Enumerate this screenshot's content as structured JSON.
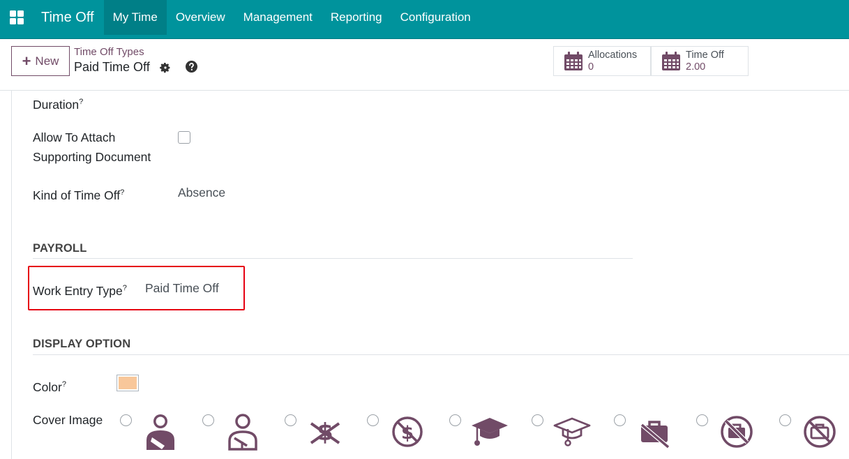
{
  "navbar": {
    "app_name": "Time Off",
    "menu": [
      "My Time",
      "Overview",
      "Management",
      "Reporting",
      "Configuration"
    ],
    "active_index": 0,
    "color": "#00939c"
  },
  "control_panel": {
    "new_label": "New",
    "breadcrumb": "Time Off Types",
    "record_title": "Paid Time Off",
    "stats": [
      {
        "label": "Allocations",
        "value": "0"
      },
      {
        "label": "Time Off",
        "value": "2.00"
      }
    ]
  },
  "form": {
    "duration_label": "Duration",
    "attach_label_1": "Allow To Attach",
    "attach_label_2": "Supporting Document",
    "kind_label": "Kind of Time Off",
    "kind_value": "Absence",
    "payroll_section": "PAYROLL",
    "work_entry_label": "Work Entry Type",
    "work_entry_value": "Paid Time Off",
    "display_section": "DISPLAY OPTION",
    "color_label": "Color",
    "color_value": "#f8c79a",
    "cover_image_label": "Cover Image",
    "help_mark": "?",
    "cover_icons": [
      "user-injured-icon",
      "user-injured-outline-icon",
      "dollar-slash-icon",
      "dollar-circle-slash-icon",
      "graduation-cap-icon",
      "graduation-cap-outline-icon",
      "briefcase-slash-icon",
      "briefcase-circle-slash-icon",
      "briefcase-outline-slash-icon"
    ]
  },
  "colors": {
    "accent": "#714b67",
    "highlight": "#e60012"
  }
}
